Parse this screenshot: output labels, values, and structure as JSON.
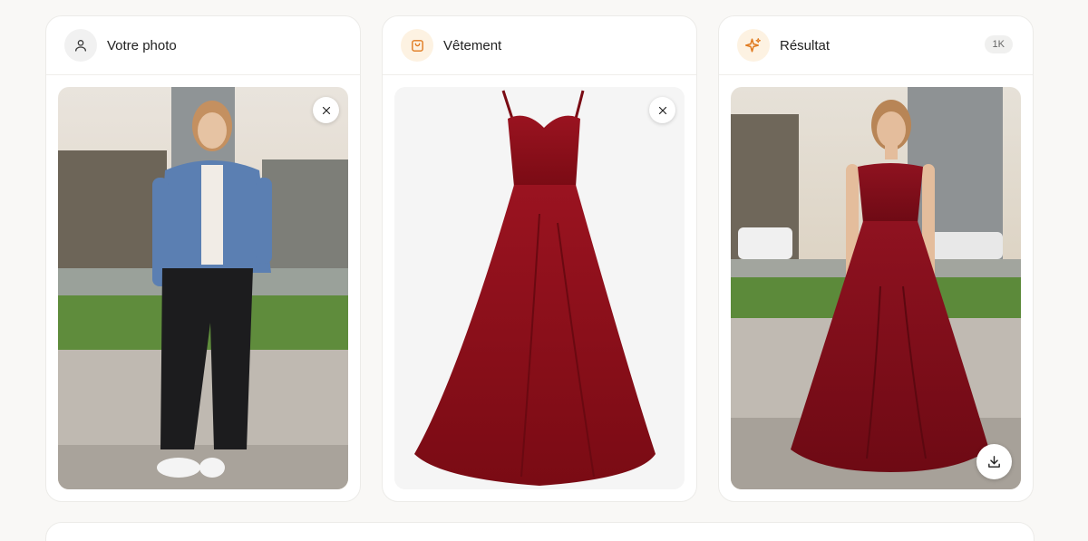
{
  "cards": [
    {
      "title": "Votre photo",
      "icon": "user-icon",
      "accent": "#3a3a3a"
    },
    {
      "title": "Vêtement",
      "icon": "shopping-bag-icon",
      "accent": "#e07a1f"
    },
    {
      "title": "Résultat",
      "icon": "sparkles-icon",
      "accent": "#e07a1f",
      "badge": "1K"
    }
  ],
  "colors": {
    "dress_red": "#8e0f1a",
    "accent_orange": "#e07a1f"
  }
}
